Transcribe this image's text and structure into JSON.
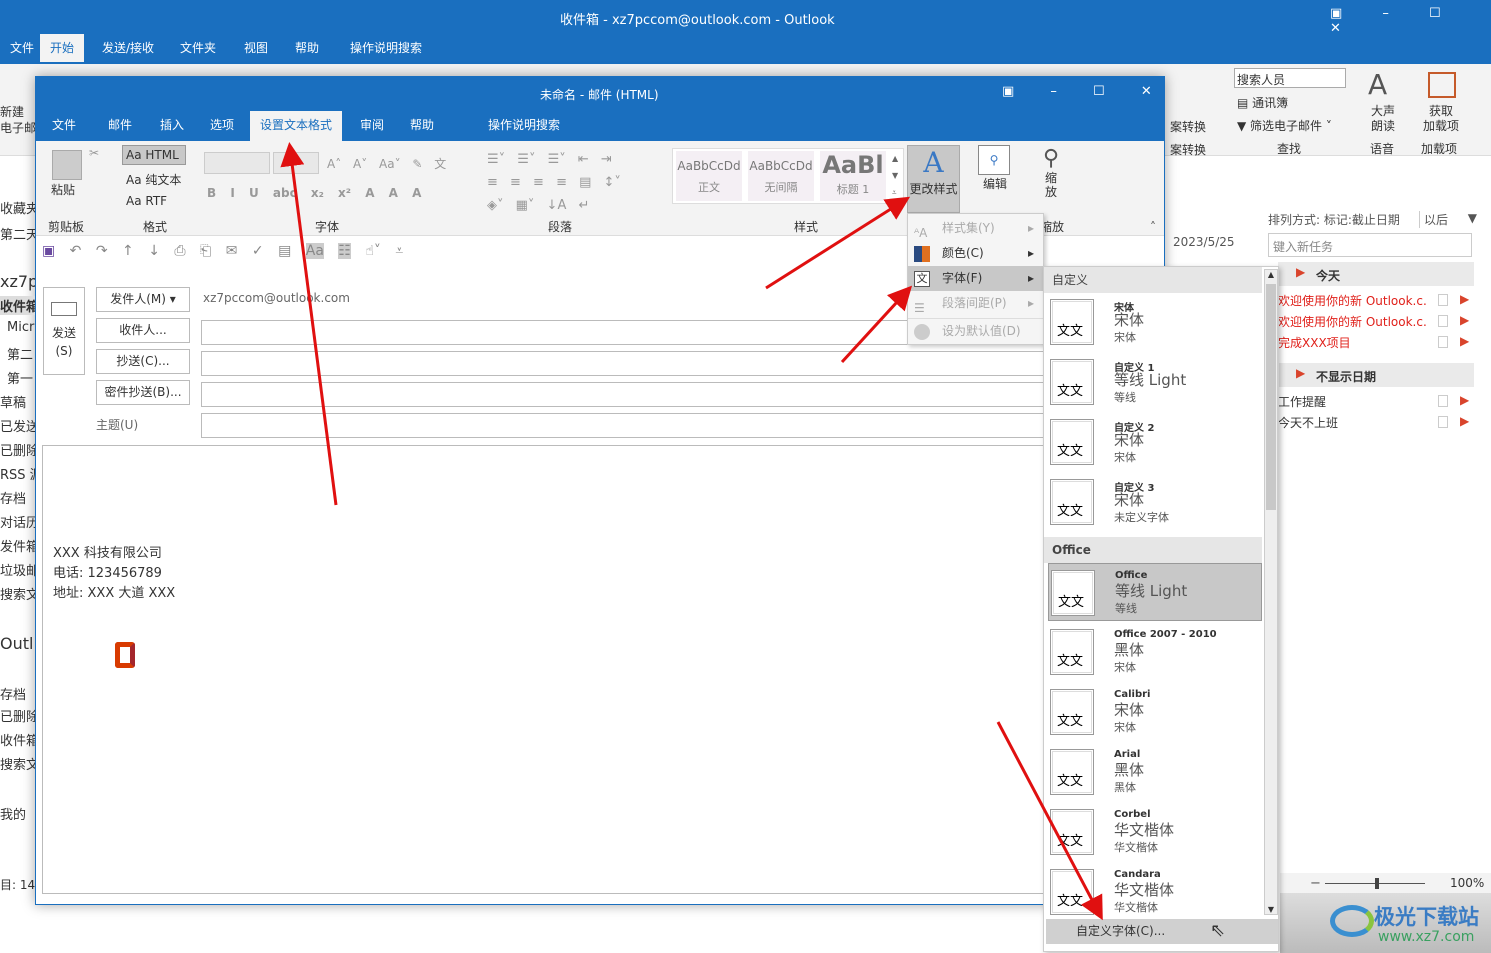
{
  "main_window": {
    "title": "收件箱 - xz7pccom@outlook.com  -  Outlook",
    "tabs": [
      "文件",
      "开始",
      "发送/接收",
      "文件夹",
      "视图",
      "帮助",
      "操作说明搜索"
    ],
    "active_tab": "开始",
    "ribbon": {
      "new_label": "新建\n电子邮件",
      "search_people": "搜索人员",
      "address_book": "通讯簿",
      "filter_email": "筛选电子邮件",
      "find_group": "查找",
      "read_aloud": "大声\n朗读",
      "speech_group": "语音",
      "get_addins": "获取\n加载项",
      "addins_group": "加载项",
      "convert1": "案转换",
      "convert2": "案转换"
    },
    "folder_pane": [
      "收藏夹",
      "第二天",
      "xz7p",
      "收件箱",
      "Micr",
      "第二",
      "第一",
      "草稿",
      "已发送",
      "已删除",
      "RSS 源",
      "存档",
      "对话历",
      "发件箱",
      "垃圾邮",
      "搜索文",
      "Outl",
      "存档",
      "已删除",
      "收件箱",
      "搜索文",
      "我的"
    ],
    "status_left": "目: 14",
    "date": "2023/5/25",
    "tasks": {
      "sort_label": "排列方式: 标记:截止日期",
      "sort_order": "以后",
      "new_task_placeholder": "键入新任务",
      "groups": [
        {
          "label": "今天",
          "items": [
            "欢迎使用你的新 Outlook.c...",
            "欢迎使用你的新 Outlook.c...",
            "完成XXX项目"
          ]
        },
        {
          "label": "不显示日期",
          "items": [
            "工作提醒",
            "今天不上班"
          ]
        }
      ]
    },
    "zoom": "100%",
    "zoom_level": 0.5
  },
  "compose": {
    "title": "未命名 - 邮件 (HTML)",
    "tabs": [
      "文件",
      "邮件",
      "插入",
      "选项",
      "设置文本格式",
      "审阅",
      "帮助",
      "操作说明搜索"
    ],
    "active_tab": "设置文本格式",
    "ribbon": {
      "paste": "粘贴",
      "clipboard_group": "剪贴板",
      "formats": [
        "Aa HTML",
        "Aa 纯文本",
        "Aa RTF"
      ],
      "format_group": "格式",
      "font_group": "字体",
      "paragraph_group": "段落",
      "styles": [
        {
          "preview": "AaBbCcDd",
          "name": "正文"
        },
        {
          "preview": "AaBbCcDd",
          "name": "无间隔"
        },
        {
          "preview": "AaBl",
          "name": "标题 1"
        }
      ],
      "styles_group": "样式",
      "change_styles": "更改样式",
      "edit": "编辑",
      "zoom": "缩\n放",
      "zoom_group": "缩放"
    },
    "send": "发送\n(S)",
    "from_btn": "发件人(M) ▾",
    "from_value": "xz7pccom@outlook.com",
    "to_btn": "收件人...",
    "cc_btn": "抄送(C)...",
    "bcc_btn": "密件抄送(B)...",
    "subject_label": "主题(U)",
    "body": [
      "XXX 科技有限公司",
      "电话:  123456789",
      "地址:  XXX 大道 XXX"
    ]
  },
  "change_styles_menu": [
    {
      "label": "样式集(Y)",
      "enabled": false,
      "submenu": true
    },
    {
      "label": "颜色(C)",
      "enabled": true,
      "submenu": true
    },
    {
      "label": "字体(F)",
      "enabled": true,
      "submenu": true,
      "highlighted": true
    },
    {
      "label": "段落间距(P)",
      "enabled": false,
      "submenu": true
    },
    {
      "label": "设为默认值(D)",
      "enabled": false,
      "submenu": false
    }
  ],
  "font_menu": {
    "sections": [
      "自定义",
      "Office"
    ],
    "custom": [
      {
        "name": "宋体",
        "heading": "宋体",
        "body": "宋体"
      },
      {
        "name": "自定义 1",
        "heading": "等线 Light",
        "body": "等线"
      },
      {
        "name": "自定义 2",
        "heading": "宋体",
        "body": "宋体"
      },
      {
        "name": "自定义 3",
        "heading": "宋体",
        "body": "未定义字体"
      }
    ],
    "office": [
      {
        "name": "Office",
        "heading": "等线 Light",
        "body": "等线",
        "selected": true
      },
      {
        "name": "Office 2007 - 2010",
        "heading": "黑体",
        "body": "宋体"
      },
      {
        "name": "Calibri",
        "heading": "宋体",
        "body": "宋体"
      },
      {
        "name": "Arial",
        "heading": "黑体",
        "body": "黑体"
      },
      {
        "name": "Corbel",
        "heading": "华文楷体",
        "body": "华文楷体"
      },
      {
        "name": "Candara",
        "heading": "华文楷体",
        "body": "华文楷体"
      }
    ],
    "preview_glyph": "文文",
    "customize": "自定义字体(C)..."
  },
  "watermark": {
    "name": "极光下载站",
    "url": "www.xz7.com"
  },
  "colors": {
    "title_blue": "#1a6fbf",
    "arrow": "#e01010",
    "flag": "#d9442c",
    "task_red": "#e0201a"
  }
}
